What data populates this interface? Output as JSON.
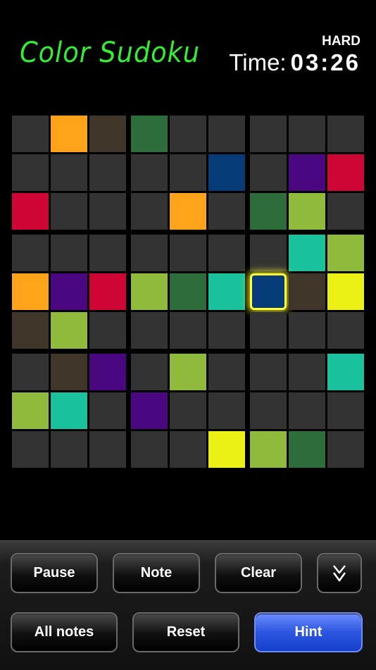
{
  "header": {
    "title": "Color Sudoku",
    "difficulty": "HARD",
    "time_label": "Time:",
    "time_value": "03:26"
  },
  "colors": {
    "empty": "#333333",
    "orange": "#ffa41a",
    "brown": "#3f3528",
    "darkgreen": "#2d6d3b",
    "navy": "#073b78",
    "purple": "#4a0780",
    "red": "#cf0535",
    "lime": "#8fba3c",
    "teal": "#19c29d",
    "yellow": "#ebf015",
    "selection_glow": "#ffff33"
  },
  "board": {
    "selected": [
      4,
      6
    ],
    "rows": [
      [
        "empty",
        "orange",
        "brown",
        "darkgreen",
        "empty",
        "empty",
        "empty",
        "empty",
        "empty"
      ],
      [
        "empty",
        "empty",
        "empty",
        "empty",
        "empty",
        "navy",
        "empty",
        "purple",
        "red"
      ],
      [
        "red",
        "empty",
        "empty",
        "empty",
        "orange",
        "empty",
        "darkgreen",
        "lime",
        "empty"
      ],
      [
        "empty",
        "empty",
        "empty",
        "empty",
        "empty",
        "empty",
        "empty",
        "teal",
        "lime"
      ],
      [
        "orange",
        "purple",
        "red",
        "lime",
        "darkgreen",
        "teal",
        "navy",
        "brown",
        "yellow"
      ],
      [
        "brown",
        "lime",
        "empty",
        "empty",
        "empty",
        "empty",
        "empty",
        "empty",
        "empty"
      ],
      [
        "empty",
        "brown",
        "purple",
        "empty",
        "lime",
        "empty",
        "empty",
        "empty",
        "teal"
      ],
      [
        "lime",
        "teal",
        "empty",
        "purple",
        "empty",
        "empty",
        "empty",
        "empty",
        "empty"
      ],
      [
        "empty",
        "empty",
        "empty",
        "empty",
        "empty",
        "yellow",
        "lime",
        "darkgreen",
        "empty"
      ]
    ]
  },
  "buttons": {
    "pause": "Pause",
    "note": "Note",
    "clear": "Clear",
    "collapse_icon": "double-chevron-down-icon",
    "all_notes": "All notes",
    "reset": "Reset",
    "hint": "Hint"
  }
}
